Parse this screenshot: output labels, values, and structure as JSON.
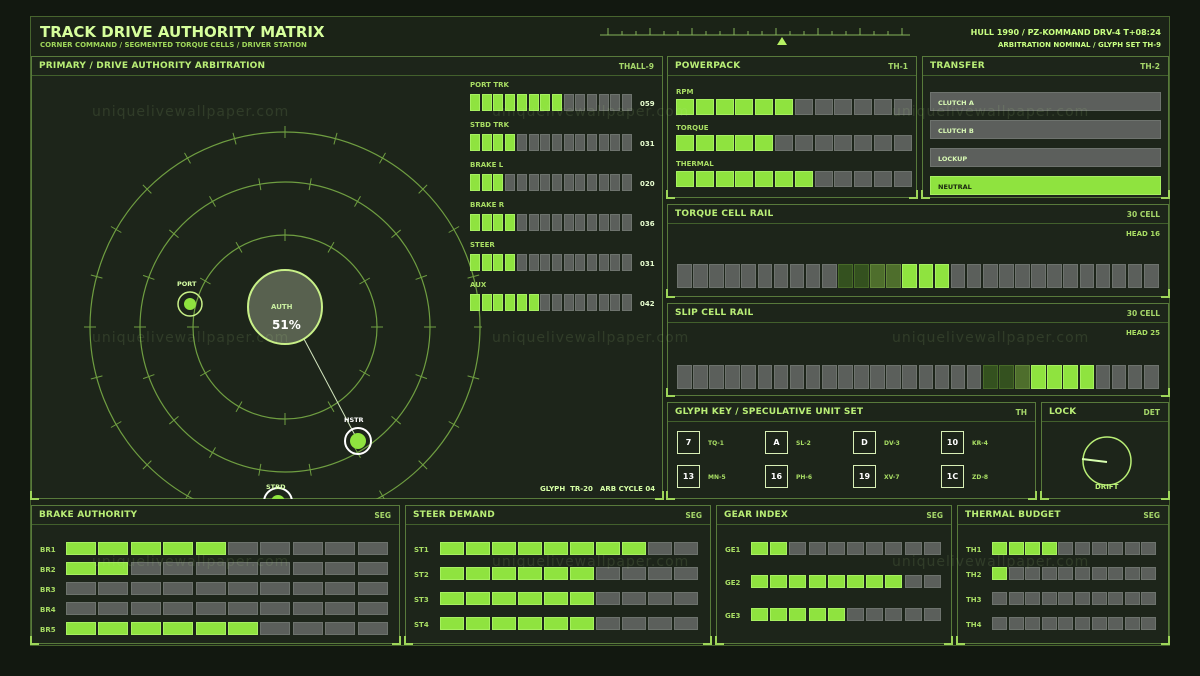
{
  "header": {
    "title": "TRACK DRIVE AUTHORITY MATRIX",
    "subtitle": "CORNER COMMAND / SEGMENTED TORQUE CELLS / DRIVER STATION",
    "status_line": "HULL 1990 / PZ-KOMMAND DRV-4 T+08:24",
    "status_line2": "ARBITRATION NOMINAL / GLYPH SET TH-9"
  },
  "primary": {
    "title": "PRIMARY / DRIVE AUTHORITY ARBITRATION",
    "code": "THALL-9",
    "auth_label": "AUTH",
    "auth_value": "51%",
    "port_label": "PORT",
    "stbd_label": "STBD",
    "hstr_label": "HSTR",
    "footer_left": "GLYPH",
    "footer_glyph": "TR-20",
    "footer_cycle": "ARB CYCLE 04",
    "bars": [
      {
        "label": "PORT TRK",
        "value": "059",
        "on": 8
      },
      {
        "label": "STBD TRK",
        "value": "031",
        "on": 4
      },
      {
        "label": "BRAKE L",
        "value": "020",
        "on": 3
      },
      {
        "label": "BRAKE R",
        "value": "036",
        "on": 4
      },
      {
        "label": "STEER",
        "value": "031",
        "on": 4
      },
      {
        "label": "AUX",
        "value": "042",
        "on": 6
      }
    ]
  },
  "powerpack": {
    "title": "POWERPACK",
    "code": "TH-1",
    "rows": [
      {
        "label": "RPM",
        "on": 6
      },
      {
        "label": "TORQUE",
        "on": 5
      },
      {
        "label": "THERMAL",
        "on": 7
      }
    ]
  },
  "transfer": {
    "title": "TRANSFER",
    "code": "TH-2",
    "items": [
      "CLUTCH A",
      "CLUTCH B",
      "LOCKUP",
      "NEUTRAL"
    ],
    "active": 3
  },
  "torque": {
    "title": "TORQUE CELL RAIL",
    "count": "30 CELL",
    "head": "HEAD 16"
  },
  "slip": {
    "title": "SLIP CELL RAIL",
    "count": "30 CELL",
    "head": "HEAD 25"
  },
  "glyph": {
    "title": "GLYPH KEY / SPECULATIVE UNIT SET",
    "code": "TH",
    "items": [
      {
        "g": "7",
        "l": "TQ-1"
      },
      {
        "g": "A",
        "l": "SL-2"
      },
      {
        "g": "D",
        "l": "DV-3"
      },
      {
        "g": "10",
        "l": "KR-4"
      },
      {
        "g": "13",
        "l": "MN-5"
      },
      {
        "g": "16",
        "l": "PH-6"
      },
      {
        "g": "19",
        "l": "XV-7"
      },
      {
        "g": "1C",
        "l": "ZD-8"
      }
    ]
  },
  "lock": {
    "title": "LOCK",
    "code": "DET",
    "dial": "DRIFT"
  },
  "brake": {
    "title": "BRAKE AUTHORITY",
    "code": "SEG",
    "rows": [
      {
        "label": "BR1",
        "on": 5
      },
      {
        "label": "BR2",
        "on": 2
      },
      {
        "label": "BR3",
        "on": 0
      },
      {
        "label": "BR4",
        "on": 0
      },
      {
        "label": "BR5",
        "on": 6
      }
    ]
  },
  "steer": {
    "title": "STEER DEMAND",
    "code": "SEG",
    "rows": [
      {
        "label": "ST1",
        "on": 8
      },
      {
        "label": "ST2",
        "on": 6
      },
      {
        "label": "ST3",
        "on": 6
      },
      {
        "label": "ST4",
        "on": 6
      }
    ]
  },
  "gear": {
    "title": "GEAR INDEX",
    "code": "SEG",
    "rows": [
      {
        "label": "GE1",
        "on": 2
      },
      {
        "label": "GE2",
        "on": 8
      },
      {
        "label": "GE3",
        "on": 5
      }
    ]
  },
  "thermal": {
    "title": "THERMAL BUDGET",
    "code": "SEG",
    "rows": [
      {
        "label": "TH1",
        "on": 4
      },
      {
        "label": "TH2",
        "on": 1
      },
      {
        "label": "TH3",
        "on": 0
      },
      {
        "label": "TH4",
        "on": 0
      }
    ]
  },
  "watermark": "uniquelivewallpaper.com"
}
